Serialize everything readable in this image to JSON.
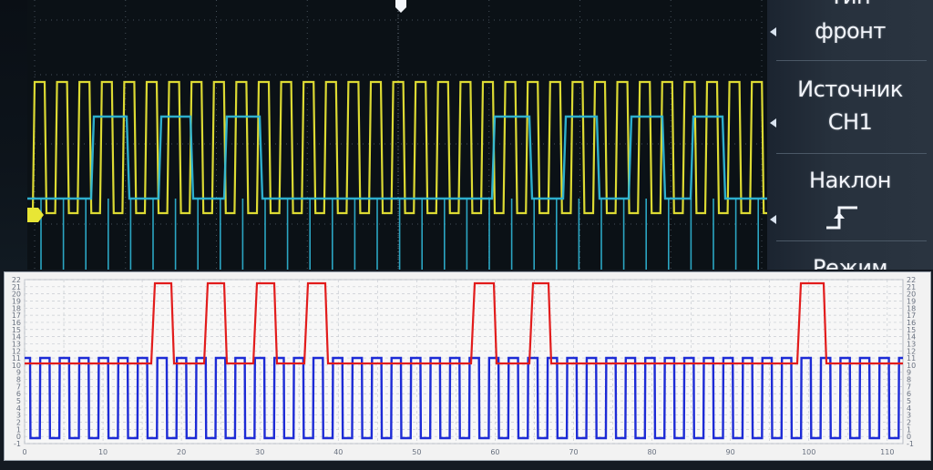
{
  "scope": {
    "menu": {
      "partial_top_label": "Тип",
      "edge_value": "фронт",
      "source_label": "Источник",
      "source_value": "CH1",
      "slope_label": "Наклон",
      "partial_bottom_label": "Режим"
    },
    "colors": {
      "ch1": "#e8e635",
      "ch2": "#2fb7d6",
      "trigger_marker": "#e8e635"
    },
    "icons": [
      "trigger-position-icon",
      "ch1-marker-icon",
      "rising-edge-icon",
      "menu-arrow-icon"
    ]
  },
  "logic": {
    "x_ticks": [
      "0",
      "10",
      "20",
      "30",
      "40",
      "50",
      "60",
      "70",
      "80",
      "90",
      "100",
      "110"
    ],
    "left_axis_ticks": [
      "22",
      "21",
      "20",
      "19",
      "18",
      "17",
      "16",
      "15",
      "14",
      "13",
      "12",
      "11",
      "10",
      "9",
      "8",
      "7",
      "6",
      "5",
      "4",
      "3",
      "2",
      "1",
      "0",
      "-1"
    ],
    "right_axis_ticks": [
      "22",
      "21",
      "20",
      "19",
      "18",
      "17",
      "16",
      "15",
      "14",
      "13",
      "12",
      "11",
      "10",
      "9",
      "8",
      "7",
      "6",
      "5",
      "4",
      "3",
      "2",
      "1",
      "0",
      "-1"
    ],
    "colors": {
      "clock": "#1d2bd6",
      "data": "#e21c1c",
      "grid": "#c8ccd2"
    }
  }
}
